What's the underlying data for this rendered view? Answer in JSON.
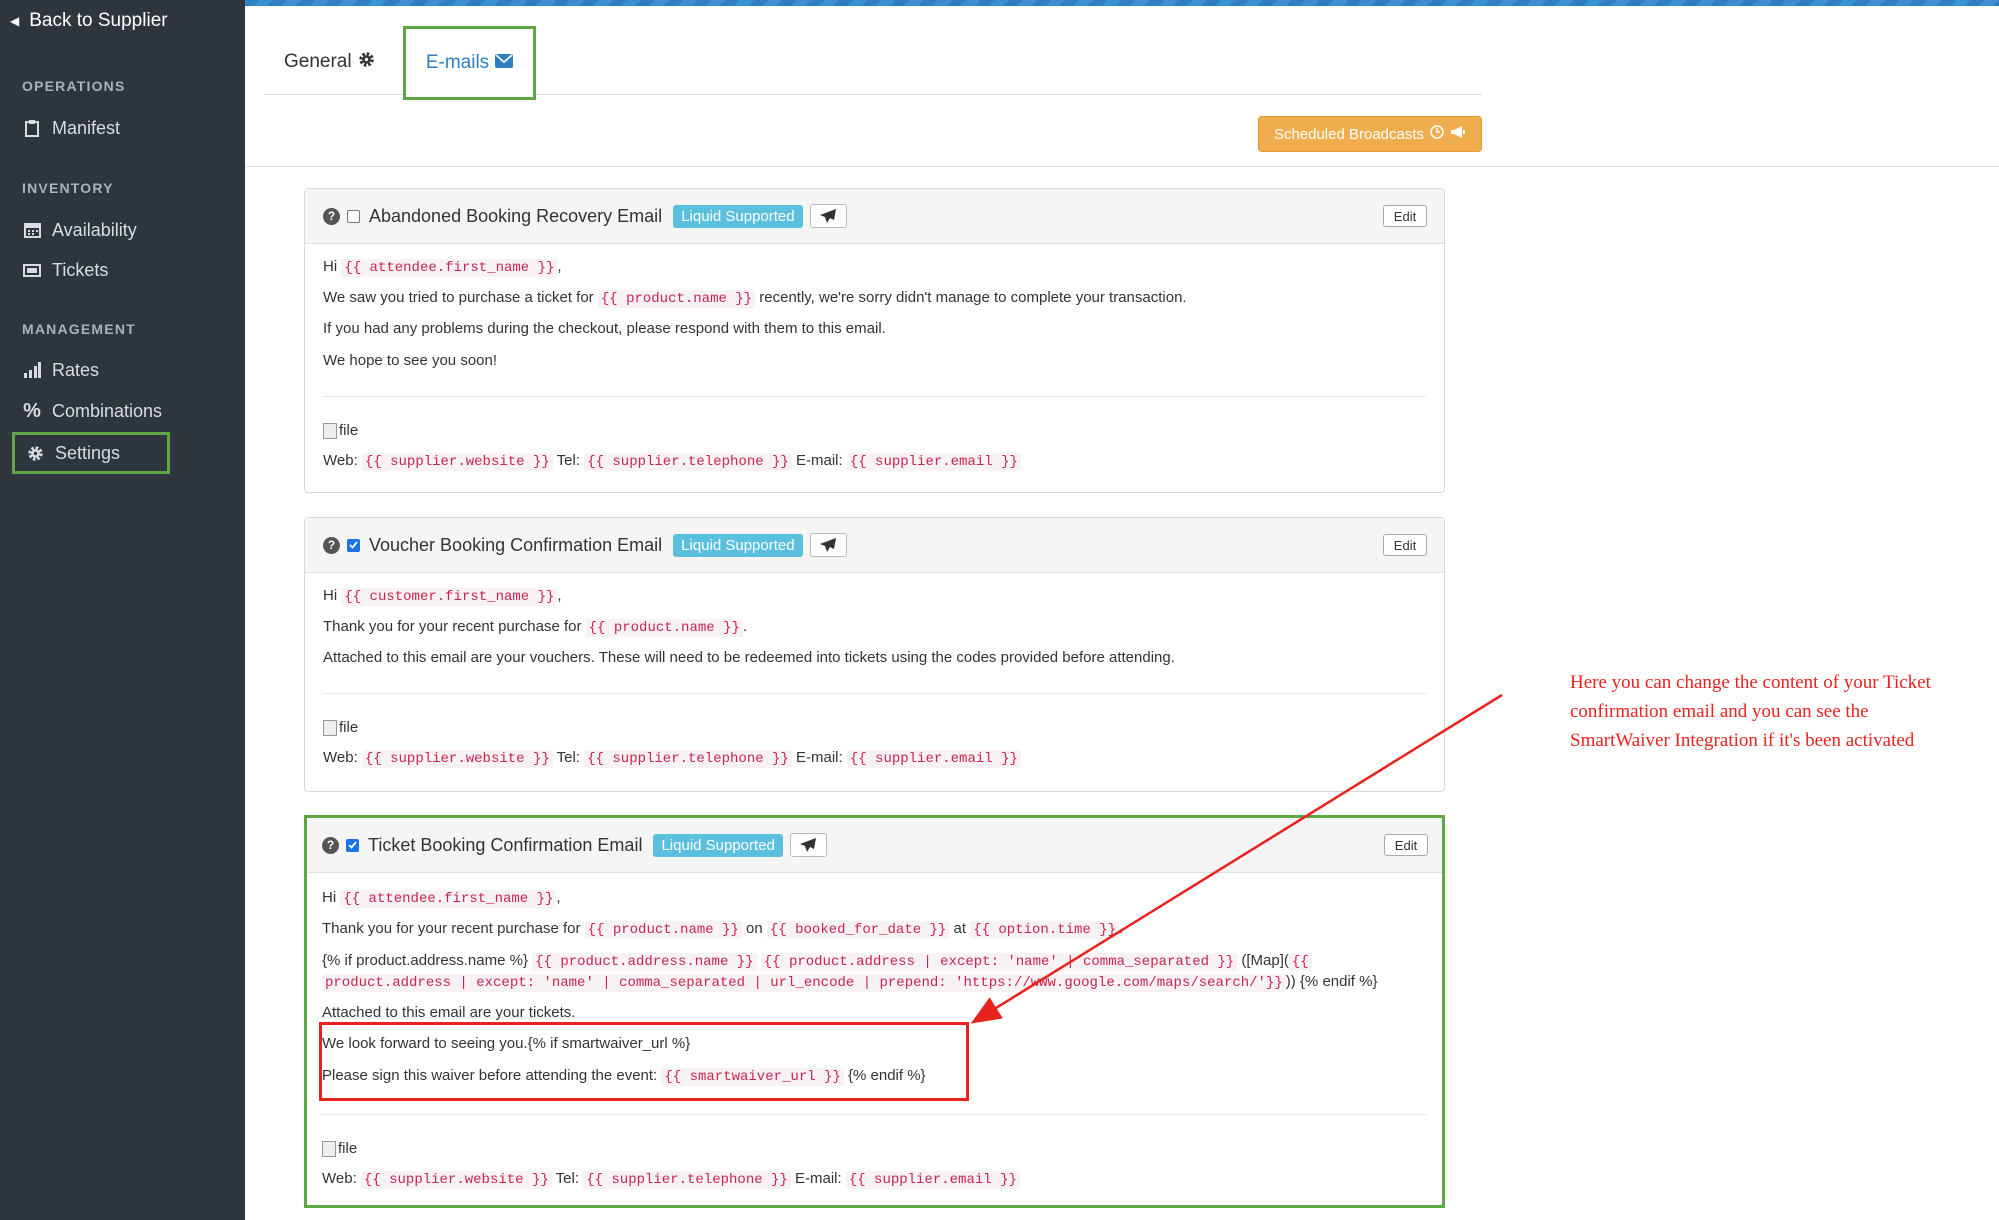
{
  "sidebar": {
    "back_label": "Back to Supplier",
    "sections": [
      {
        "title": "OPERATIONS",
        "items": [
          {
            "label": "Manifest",
            "icon": "clipboard-icon"
          }
        ]
      },
      {
        "title": "INVENTORY",
        "items": [
          {
            "label": "Availability",
            "icon": "calendar-icon"
          },
          {
            "label": "Tickets",
            "icon": "ticket-icon"
          }
        ]
      },
      {
        "title": "MANAGEMENT",
        "items": [
          {
            "label": "Rates",
            "icon": "bar-chart-icon"
          },
          {
            "label": "Combinations",
            "icon": "percent-icon"
          },
          {
            "label": "Settings",
            "icon": "gear-icon",
            "active": true
          }
        ]
      }
    ]
  },
  "tabs": {
    "general": "General",
    "emails": "E-mails",
    "active": "E-mails"
  },
  "toolbar": {
    "scheduled_broadcasts": "Scheduled Broadcasts"
  },
  "common": {
    "badge": "Liquid Supported",
    "edit": "Edit",
    "file_alt": "file",
    "web": "Web:",
    "tel": "Tel:",
    "email": "E-mail:",
    "var_website": "{{ supplier.website }}",
    "var_telephone": "{{ supplier.telephone }}",
    "var_email": "{{ supplier.email }}"
  },
  "emails": [
    {
      "title": "Abandoned Booking Recovery Email",
      "enabled": false,
      "hi": "Hi",
      "hi_var": "{{ attendee.first_name }}",
      "comma": ",",
      "l2a": "We saw you tried to purchase a ticket for",
      "l2var": "{{ product.name }}",
      "l2b": "recently, we're sorry didn't manage to complete your transaction.",
      "l3": "If you had any problems during the checkout, please respond with them to this email.",
      "l4": "We hope to see you soon!"
    },
    {
      "title": "Voucher Booking Confirmation Email",
      "enabled": true,
      "hi": "Hi",
      "hi_var": "{{ customer.first_name }}",
      "comma": ",",
      "l2a": "Thank you for your recent purchase for",
      "l2var": "{{ product.name }}",
      "l2b": ".",
      "l3": "Attached to this email are your vouchers. These will need to be redeemed into tickets using the codes provided before attending."
    },
    {
      "title": "Ticket Booking Confirmation Email",
      "enabled": true,
      "hi": "Hi",
      "hi_var": "{{ attendee.first_name }}",
      "comma": ",",
      "l2a": "Thank you for your recent purchase for",
      "l2var1": "{{ product.name }}",
      "on": "on",
      "l2var2": "{{ booked_for_date }}",
      "at": "at",
      "l2var3": "{{ option.time }}",
      "l2b": ".",
      "l3a": "{% if product.address.name %}",
      "l3var1": "{{ product.address.name }}",
      "l3var2": "{{ product.address | except: 'name' | comma_separated }}",
      "l3b": "([Map](",
      "l3var3a": "{{",
      "l3var3b": "product.address | except: 'name' | comma_separated | url_encode | prepend: 'https://www.google.com/maps/search/'}}",
      "l3c": ")) {% endif %}",
      "l4": "Attached to this email are your tickets.",
      "l5": "We look forward to seeing you.{% if smartwaiver_url %}",
      "l6a": "Please sign this waiver before attending the event:",
      "l6var": "{{ smartwaiver_url }}",
      "l6b": "{% endif %}"
    }
  ],
  "annotation": {
    "note": "Here you can change the content of your Ticket confirmation email and you can see the SmartWaiver Integration if it's been activated",
    "color": "#e8231f"
  },
  "colors": {
    "sidebar_bg": "#2f353d",
    "highlight_green": "#5ea744",
    "accent_blue": "#2e7fbf",
    "badge_blue": "#5bc0de",
    "warning_orange": "#f0ad4e",
    "code_red": "#c7254e"
  }
}
